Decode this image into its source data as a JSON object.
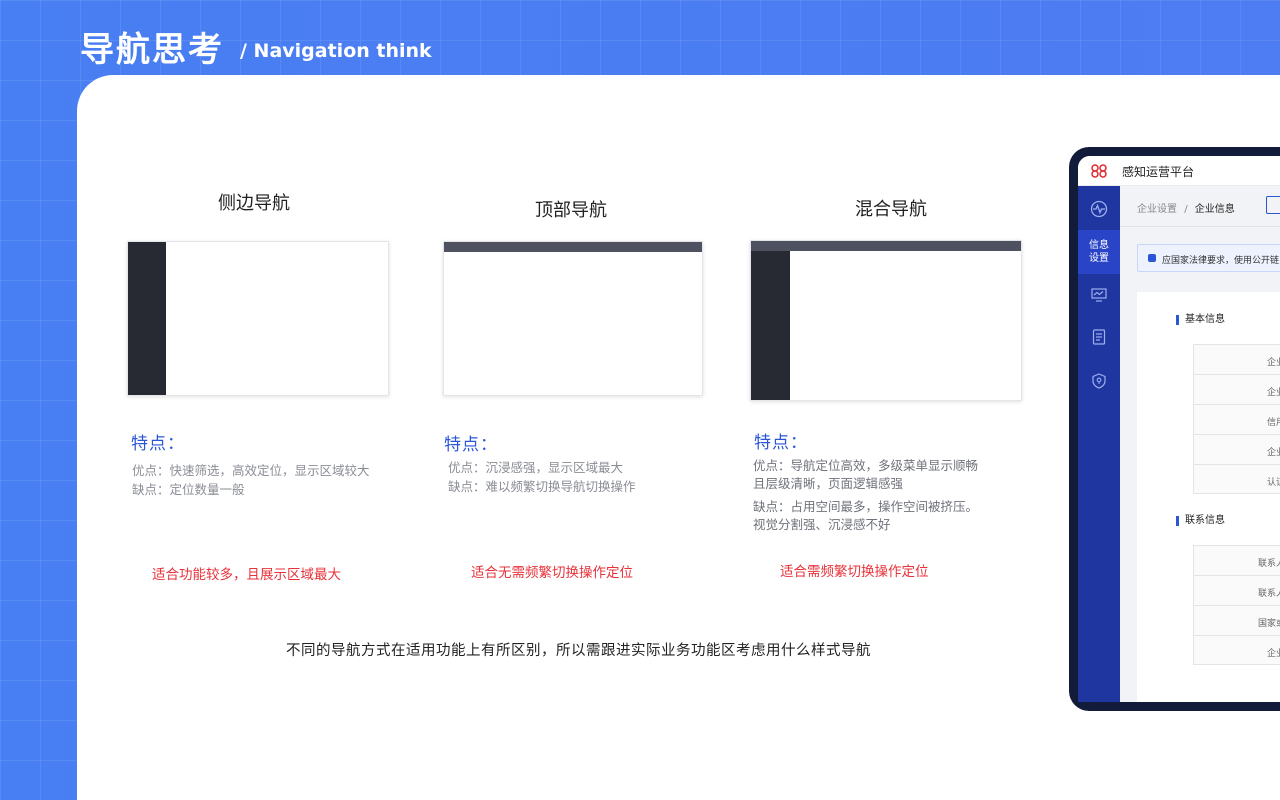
{
  "header": {
    "title_cn": "导航思考",
    "title_en": "/ Navigation think"
  },
  "columns": [
    {
      "title": "侧边导航",
      "layout": "side",
      "feature_heading": "特点：",
      "pros": "优点：快速筛选，高效定位，显示区域较大",
      "cons": "缺点：定位数量一般",
      "note": "适合功能较多，且展示区域最大"
    },
    {
      "title": "顶部导航",
      "layout": "top",
      "feature_heading": "特点：",
      "pros": "优点：沉浸感强，显示区域最大",
      "cons": "缺点：难以频繁切换导航切换操作",
      "note": "适合无需频繁切换操作定位"
    },
    {
      "title": "混合导航",
      "layout": "mixed",
      "feature_heading": "特点：",
      "pros_line1": "优点：导航定位高效，多级菜单显示顺畅",
      "pros_line2": "且层级清晰，页面逻辑感强",
      "cons_line1": "缺点：占用空间最多，操作空间被挤压。",
      "cons_line2": "视觉分割强、沉浸感不好",
      "note": "适合需频繁切换操作定位"
    }
  ],
  "summary": "不同的导航方式在适用功能上有所区别，所以需跟进实际业务功能区考虑用什么样式导航",
  "mockup": {
    "app_name": "感知运营平台",
    "sidebar_active": "信息\n设置",
    "breadcrumb_parent": "企业设置",
    "breadcrumb_sep": "/",
    "breadcrumb_current": "企业信息",
    "notice": "应国家法律要求，使用公开链",
    "section_basic": "基本信息",
    "basic_rows": [
      "企业全",
      "企业编",
      "信用代",
      "企业行",
      "认证状"
    ],
    "section_contact": "联系信息",
    "contact_rows": [
      "联系人姓",
      "联系人座",
      "国家或地",
      "企业地"
    ]
  },
  "colors": {
    "accent_blue": "#2a56d6",
    "note_red": "#e8323a",
    "nav_dark": "#282a33",
    "sidebar_blue": "#1f35a0"
  }
}
